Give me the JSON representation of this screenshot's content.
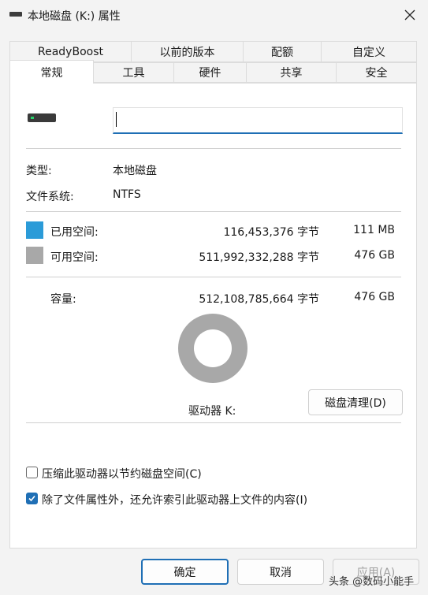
{
  "window": {
    "title": "本地磁盘 (K:) 属性",
    "close_icon": "close-icon"
  },
  "tabs": {
    "row1": [
      "ReadyBoost",
      "以前的版本",
      "配额",
      "自定义"
    ],
    "row2": [
      "常规",
      "工具",
      "硬件",
      "共享",
      "安全"
    ],
    "active": "常规"
  },
  "general": {
    "name_value": "",
    "type_label": "类型:",
    "type_value": "本地磁盘",
    "fs_label": "文件系统:",
    "fs_value": "NTFS",
    "used": {
      "label": "已用空间:",
      "bytes": "116,453,376 字节",
      "size": "111 MB",
      "color": "#2b9bd8"
    },
    "free": {
      "label": "可用空间:",
      "bytes": "511,992,332,288 字节",
      "size": "476 GB",
      "color": "#a8a8a8"
    },
    "capacity": {
      "label": "容量:",
      "bytes": "512,108,785,664 字节",
      "size": "476 GB"
    },
    "drive_label": "驱动器 K:",
    "cleanup_button": "磁盘清理(D)",
    "compress_label": "压缩此驱动器以节约磁盘空间(C)",
    "compress_checked": false,
    "index_label": "除了文件属性外，还允许索引此驱动器上文件的内容(I)",
    "index_checked": true
  },
  "footer": {
    "ok": "确定",
    "cancel": "取消",
    "apply": "应用(A)"
  },
  "watermark": "头条 @数码小能手"
}
